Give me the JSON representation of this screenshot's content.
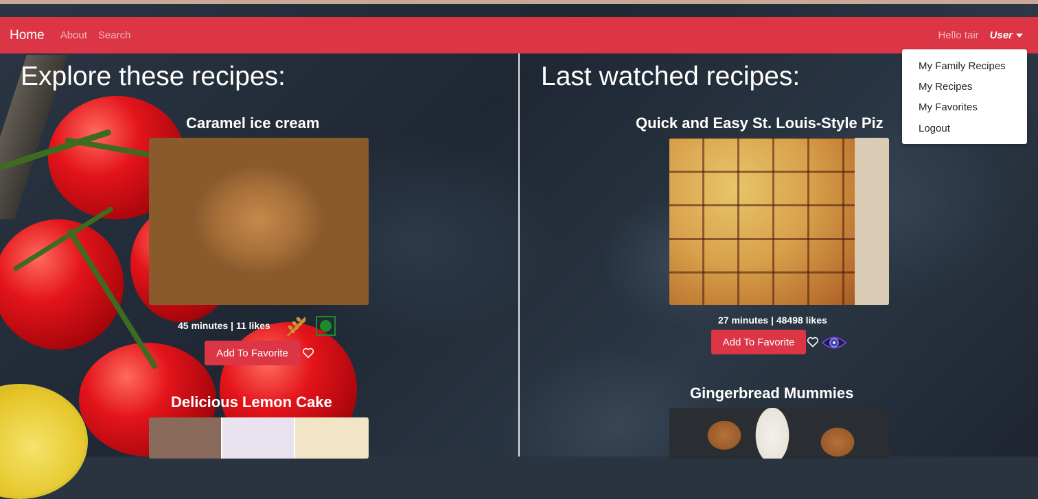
{
  "navbar": {
    "brand": "Home",
    "links": [
      "About",
      "Search"
    ],
    "greeting": "Hello tair",
    "user_label": "User"
  },
  "user_menu": {
    "items": [
      "My Family Recipes",
      "My Recipes",
      "My Favorites",
      "Logout"
    ]
  },
  "explore": {
    "title": "Explore these recipes:",
    "recipes": [
      {
        "name": "Caramel ice cream",
        "meta": "45 minutes | 11 likes",
        "button": "Add To Favorite"
      },
      {
        "name": "Delicious Lemon Cake"
      }
    ]
  },
  "watched": {
    "title": "Last watched recipes:",
    "recipes": [
      {
        "name": "Quick and Easy St. Louis-Style Piz",
        "meta": "27 minutes | 48498 likes",
        "button": "Add To Favorite"
      },
      {
        "name": "Gingerbread Mummies"
      }
    ]
  },
  "colors": {
    "brand": "#dc3545",
    "vegetarian_green": "#1d8a2a"
  }
}
